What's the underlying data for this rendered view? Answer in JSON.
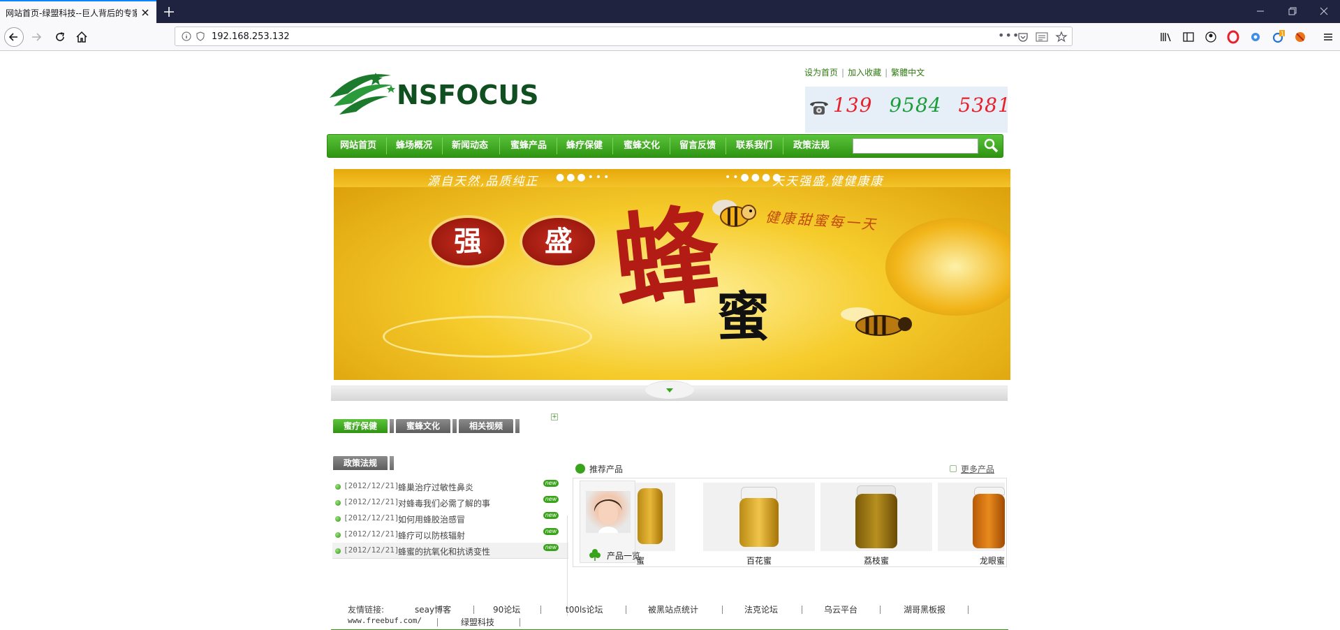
{
  "browser": {
    "tab_title": "网站首页-绿盟科技--巨人背后的专家",
    "url": "192.168.253.132",
    "extension_badge": "1"
  },
  "header": {
    "logo_text": "NSFOCUS",
    "top_links": [
      "设为首页",
      "加入收藏",
      "繁體中文"
    ],
    "phone": [
      "139",
      "9584",
      "5381"
    ],
    "phone_colors": [
      "#e8202a",
      "#1b9e3a",
      "#e8202a"
    ]
  },
  "menu": {
    "items": [
      "网站首页",
      "蜂场概况",
      "新闻动态",
      "蜜蜂产品",
      "蜂疗保健",
      "蜜蜂文化",
      "留言反馈",
      "联系我们",
      "政策法规"
    ],
    "search_placeholder": ""
  },
  "banner": {
    "slogan_left": "源自天然,品质纯正",
    "slogan_right": "天天强盛,健健康康",
    "sub_slogan": "健康甜蜜每一天",
    "seal_chars": [
      "强",
      "盛"
    ],
    "big_char_1": "蜂",
    "big_char_2": "蜜"
  },
  "left_panel": {
    "tabs": [
      "蜜疗保健",
      "蜜蜂文化",
      "相关视频",
      "政策法规"
    ],
    "news": [
      {
        "date": "[2012/12/21]",
        "title": "蜂巢治疗过敏性鼻炎",
        "badge": "new"
      },
      {
        "date": "[2012/12/21]",
        "title": "对蜂毒我们必需了解的事",
        "badge": "new"
      },
      {
        "date": "[2012/12/21]",
        "title": "如何用蜂胶治感冒",
        "badge": "new"
      },
      {
        "date": "[2012/12/21]",
        "title": "蜂疗可以防核辐射",
        "badge": "new"
      },
      {
        "date": "[2012/12/21]",
        "title": "蜂蜜的抗氧化和抗诱变性",
        "badge": "new"
      }
    ]
  },
  "right_panel": {
    "title": "推荐产品",
    "more": "更多产品",
    "overlay_label": "产品一览",
    "products": [
      "蜜",
      "百花蜜",
      "荔枝蜜",
      "龙眼蜜"
    ]
  },
  "footer": {
    "label": "友情链接:",
    "links": [
      "seay博客",
      "90论坛",
      "t00ls论坛",
      "被黑站点统计",
      "法克论坛",
      "乌云平台",
      "湖哥黑板报",
      "www.freebuf.com/",
      "绿盟科技"
    ]
  }
}
